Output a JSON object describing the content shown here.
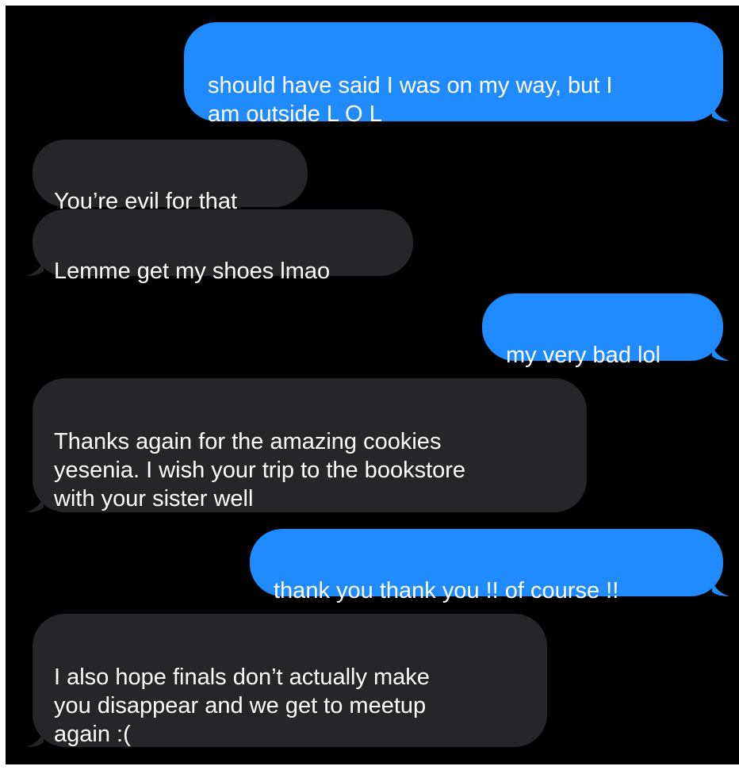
{
  "colors": {
    "background": "#000000",
    "outgoing_bubble": "#1f8bff",
    "incoming_bubble": "#262628",
    "text": "#ffffff"
  },
  "messages": [
    {
      "direction": "outgoing",
      "text": "should have said I was on my way, but I\nam outside L O L"
    },
    {
      "direction": "incoming",
      "text": "You’re evil for that"
    },
    {
      "direction": "incoming",
      "text": "Lemme get my shoes lmao"
    },
    {
      "direction": "outgoing",
      "text": "my very bad lol"
    },
    {
      "direction": "incoming",
      "text": "Thanks again for the amazing cookies\nyesenia. I wish your trip to the bookstore\nwith your sister well"
    },
    {
      "direction": "outgoing",
      "text": "thank you thank you !! of course !!"
    },
    {
      "direction": "incoming",
      "text": "I also hope finals don’t actually make\nyou disappear and we get to meetup\nagain :("
    }
  ]
}
